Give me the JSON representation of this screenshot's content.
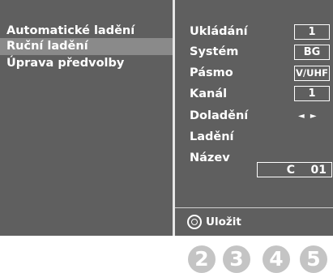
{
  "left_menu": {
    "items": [
      {
        "label": "Automatické ladění",
        "selected": false
      },
      {
        "label": "Ruční ladění",
        "selected": true
      },
      {
        "label": "Úprava předvolby",
        "selected": false
      }
    ]
  },
  "settings": {
    "storage_label": "Ukládání",
    "storage_value": "1",
    "system_label": "Systém",
    "system_value": "BG",
    "band_label": "Pásmo",
    "band_value": "V/UHF",
    "channel_label": "Kanál",
    "channel_value": "1",
    "fine_tuning_label": "Doladění",
    "fine_tuning_arrows": "◄ ►",
    "tuning_label": "Ladění",
    "name_label": "Název",
    "name_value": "C    01"
  },
  "footer": {
    "save_label": "Uložit",
    "ok_icon": "ok-circle-icon"
  },
  "steps": [
    "2",
    "3",
    "4",
    "5"
  ],
  "colors": {
    "panel_bg": "#5f5f5f",
    "selected_bg": "#8a8a8a",
    "step_circle": "#c4c4c4",
    "text": "#ffffff"
  }
}
